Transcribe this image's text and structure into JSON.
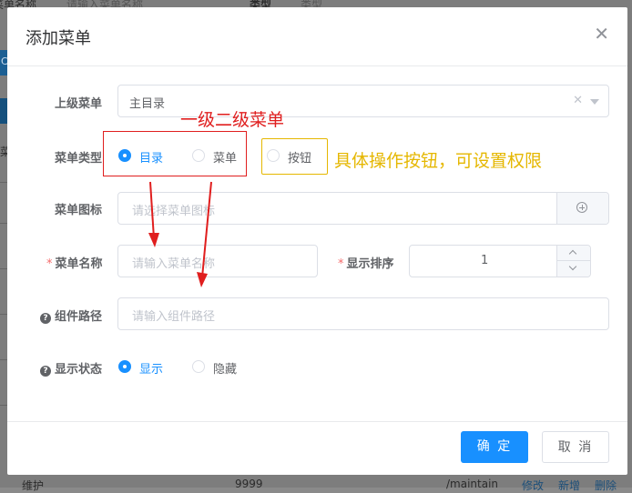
{
  "background": {
    "search_label": "菜单名称",
    "search_placeholder": "请输入菜单名称",
    "type_label": "类型",
    "type_placeholder": "类型",
    "left_letters": [
      "C",
      "菜"
    ],
    "bottom_row": {
      "name": "维护",
      "order": "9999",
      "path": "/maintain",
      "action_edit": "修改",
      "action_add": "新增",
      "action_delete": "删除"
    }
  },
  "dialog": {
    "title": "添加菜单",
    "close_icon": "close-icon",
    "fields": {
      "parent": {
        "label": "上级菜单",
        "value": "主目录"
      },
      "menu_type": {
        "label": "菜单类型",
        "options": [
          {
            "label": "目录",
            "selected": true
          },
          {
            "label": "菜单",
            "selected": false
          },
          {
            "label": "按钮",
            "selected": false
          }
        ]
      },
      "icon": {
        "label": "菜单图标",
        "placeholder": "请选择菜单图标",
        "append_icon": "plus-circle-icon"
      },
      "name": {
        "label": "菜单名称",
        "required": "*",
        "placeholder": "请输入菜单名称"
      },
      "order": {
        "label": "显示排序",
        "required": "*",
        "value": "1"
      },
      "component": {
        "label": "组件路径",
        "help": "?",
        "placeholder": "请输入组件路径"
      },
      "visible": {
        "label": "显示状态",
        "help": "?",
        "options": [
          {
            "label": "显示",
            "selected": true
          },
          {
            "label": "隐藏",
            "selected": false
          }
        ]
      }
    },
    "footer": {
      "confirm": "确 定",
      "cancel": "取 消"
    }
  },
  "annotations": {
    "red_note": "一级二级菜单",
    "yellow_note": "具体操作按钮，可设置权限",
    "colors": {
      "red": "#e01e1e",
      "yellow": "#e5b700",
      "primary": "#1890ff"
    }
  }
}
